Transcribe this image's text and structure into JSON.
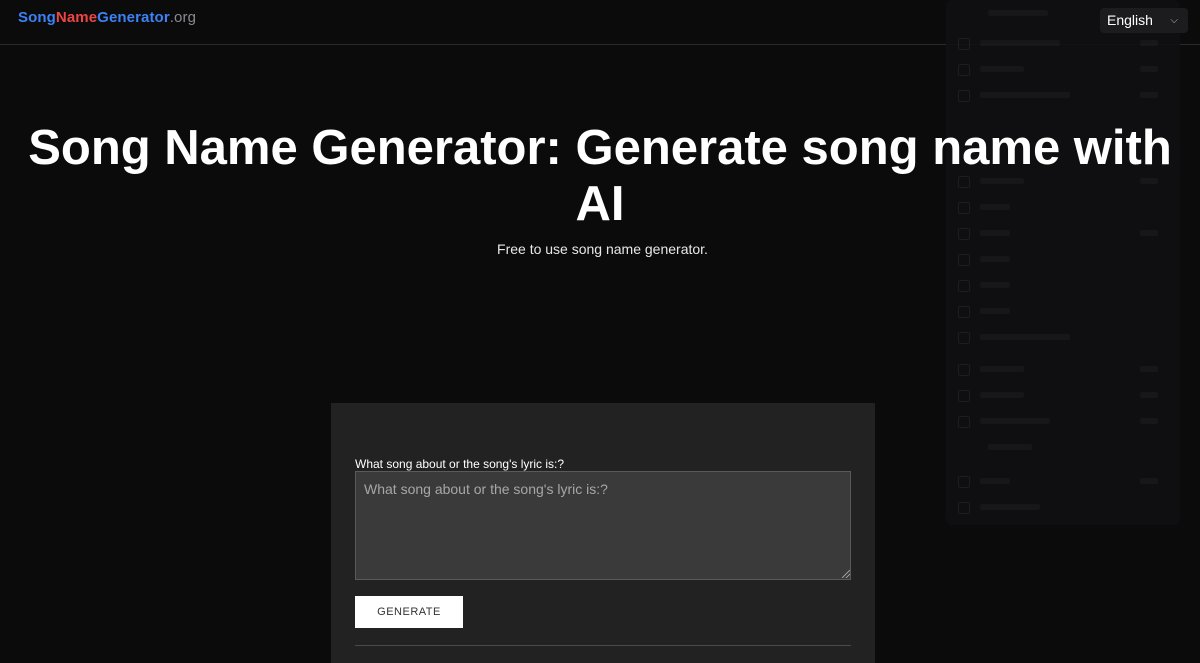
{
  "header": {
    "logo": {
      "part1": "Song",
      "part2": "Name",
      "part3": "Generator",
      "part4": ".org"
    },
    "language": {
      "selected": "English",
      "icon": "chevron-down-icon"
    }
  },
  "hero": {
    "title": "Song Name Generator: Generate song name with AI",
    "subtitle": "Free to use song name generator."
  },
  "form": {
    "field_label": "What song about or the song's lyric is:?",
    "placeholder": "What song about or the song's lyric is:?",
    "value": "",
    "button_label": "GENERATE"
  },
  "colors": {
    "background": "#0b0b0c",
    "panel": "#222223",
    "logo_blue": "#3b82f6",
    "logo_red": "#ef4444"
  }
}
